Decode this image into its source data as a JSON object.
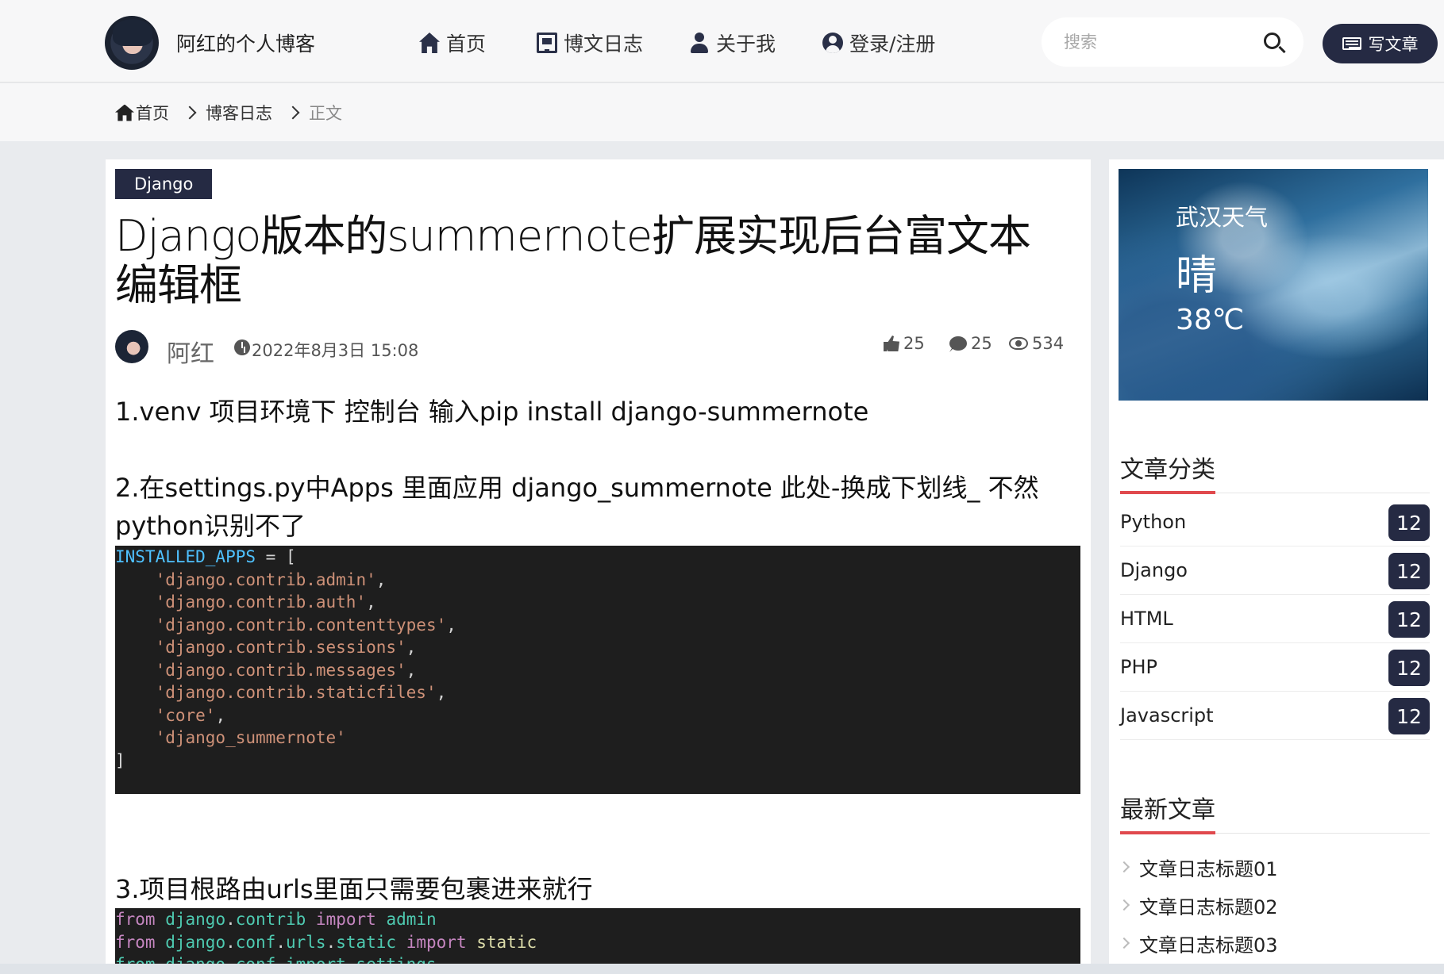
{
  "nav": {
    "brand": "阿红的个人博客",
    "items": [
      {
        "label": "首页",
        "icon": "home-icon"
      },
      {
        "label": "博文日志",
        "icon": "newspaper-icon"
      },
      {
        "label": "关于我",
        "icon": "user-tie-icon"
      },
      {
        "label": "登录/注册",
        "icon": "user-circle-icon"
      }
    ],
    "search_placeholder": "搜索",
    "write_label": "写文章"
  },
  "breadcrumb": {
    "home": "首页",
    "section": "博客日志",
    "current": "正文"
  },
  "article": {
    "tag": "Django",
    "title": "Django版本的summernote扩展实现后台富文本编辑框",
    "author": "阿红",
    "date": "2022年8月3日 15:08",
    "likes": "25",
    "comments": "25",
    "views": "534",
    "p1": "1.venv 项目环境下  控制台  输入pip install django-summernote",
    "p2": "2.在settings.py中Apps 里面应用 django_summernote  此处-换成下划线_ 不然python识别不了",
    "p3": "3.项目根路由urls里面只需要包裹进来就行",
    "code1": {
      "var": "INSTALLED_APPS",
      "assign": " = [",
      "items": [
        "'django.contrib.admin'",
        "'django.contrib.auth'",
        "'django.contrib.contenttypes'",
        "'django.contrib.sessions'",
        "'django.contrib.messages'",
        "'django.contrib.staticfiles'",
        "'core'",
        "'django_summernote'"
      ],
      "close": "]"
    },
    "code2": {
      "from": "from",
      "import": "import",
      "line1_mod_a": "django",
      "line1_mod_b": "contrib",
      "line1_name": "admin",
      "line2_mod_a": "django",
      "line2_mod_b": "conf",
      "line2_mod_c": "urls",
      "line2_mod_d": "static",
      "line2_name": "static",
      "line3": "from django.conf import settings"
    }
  },
  "weather": {
    "city": "武汉天气",
    "condition": "晴",
    "temp": "38℃"
  },
  "categories": {
    "heading": "文章分类",
    "items": [
      {
        "name": "Python",
        "count": "12"
      },
      {
        "name": "Django",
        "count": "12"
      },
      {
        "name": "HTML",
        "count": "12"
      },
      {
        "name": "PHP",
        "count": "12"
      },
      {
        "name": "Javascript",
        "count": "12"
      }
    ]
  },
  "recent": {
    "heading": "最新文章",
    "items": [
      "文章日志标题01",
      "文章日志标题02",
      "文章日志标题03"
    ]
  },
  "colors": {
    "primary": "#252a43",
    "accent": "#e0494d",
    "code_bg": "#1e1e1e"
  }
}
